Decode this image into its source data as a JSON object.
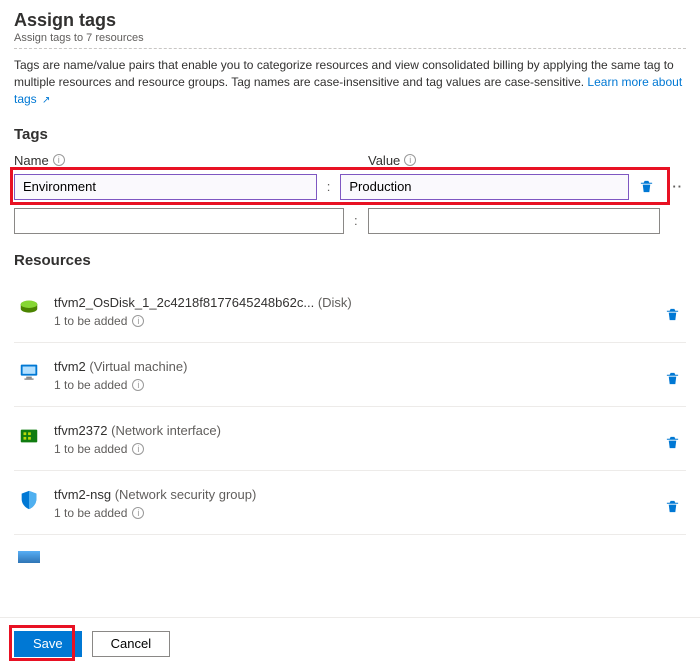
{
  "header": {
    "title": "Assign tags",
    "subtitle": "Assign tags to 7 resources"
  },
  "description": {
    "text": "Tags are name/value pairs that enable you to categorize resources and view consolidated billing by applying the same tag to multiple resources and resource groups. Tag names are case-insensitive and tag values are case-sensitive. ",
    "link_text": "Learn more about tags"
  },
  "tags": {
    "section_title": "Tags",
    "name_label": "Name",
    "value_label": "Value",
    "rows": [
      {
        "name": "Environment",
        "value": "Production"
      },
      {
        "name": "",
        "value": ""
      }
    ]
  },
  "resources": {
    "section_title": "Resources",
    "status_text": "1 to be added",
    "items": [
      {
        "name": "tfvm2_OsDisk_1_2c4218f8177645248b62c...",
        "type": "(Disk)",
        "icon": "disk"
      },
      {
        "name": "tfvm2",
        "type": "(Virtual machine)",
        "icon": "vm"
      },
      {
        "name": "tfvm2372",
        "type": "(Network interface)",
        "icon": "nic"
      },
      {
        "name": "tfvm2-nsg",
        "type": "(Network security group)",
        "icon": "nsg"
      }
    ]
  },
  "footer": {
    "save": "Save",
    "cancel": "Cancel"
  }
}
